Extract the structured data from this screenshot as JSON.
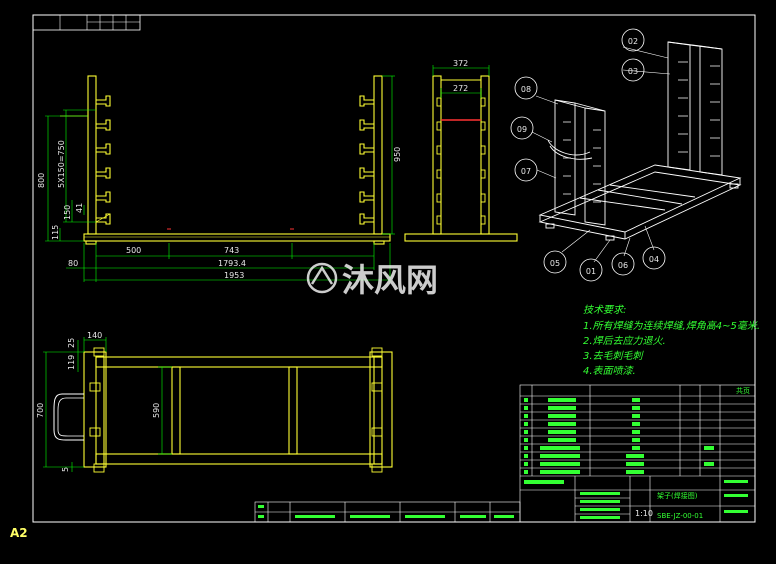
{
  "sheet": {
    "size_label": "A2",
    "title_block_cells": [
      "",
      "",
      "",
      "",
      "",
      ""
    ]
  },
  "colors": {
    "background": "#000000",
    "frame": "#ffffff",
    "part": "#ffff33",
    "dimension": "#00ff00",
    "callout": "#ffffff",
    "note": "#33ff33",
    "table_text": "#33ff33"
  },
  "front_view": {
    "dims": {
      "d800": "800",
      "d5x150": "5X150=750",
      "d150": "150",
      "d115": "115",
      "d41": "41",
      "d500": "500",
      "d743": "743",
      "d1793": "1793.4",
      "d1953": "1953",
      "d80": "80",
      "d950": "950"
    }
  },
  "side_view": {
    "dims": {
      "d372": "372",
      "d272": "272"
    }
  },
  "top_view": {
    "dims": {
      "d140": "140",
      "d25": "25",
      "d119": "119",
      "d700": "700",
      "d590": "590",
      "d5": "5"
    }
  },
  "iso_view": {
    "callouts": [
      "02",
      "03",
      "08",
      "09",
      "07",
      "05",
      "01",
      "06",
      "04"
    ]
  },
  "tech_notes": {
    "title": "技术要求:",
    "items": [
      "1.所有焊缝为连续焊缝,焊角高4~5毫米.",
      "2.焊后去应力退火.",
      "3.去毛刺毛刺",
      "4.表面喷漆."
    ]
  },
  "watermark": {
    "text": "沐风网"
  },
  "bom": {
    "header_right": "共页",
    "rows": [
      [
        "9",
        "",
        "",
        "1",
        "",
        ""
      ],
      [
        "8",
        "",
        "",
        "1",
        "",
        ""
      ],
      [
        "7",
        "",
        "",
        "2",
        "",
        ""
      ],
      [
        "6",
        "",
        "",
        "1",
        "",
        ""
      ],
      [
        "5",
        "",
        "",
        "2",
        "",
        ""
      ],
      [
        "4",
        "",
        "",
        "1",
        "",
        ""
      ],
      [
        "3",
        "",
        "",
        "2",
        "",
        ""
      ],
      [
        "2",
        "",
        "",
        "2",
        "",
        ""
      ],
      [
        "1",
        "",
        "",
        "1",
        "",
        ""
      ]
    ],
    "drawing_title": "架子(焊接图)",
    "drawing_number": "SBE-JZ-00-01",
    "scale": "1:10"
  }
}
